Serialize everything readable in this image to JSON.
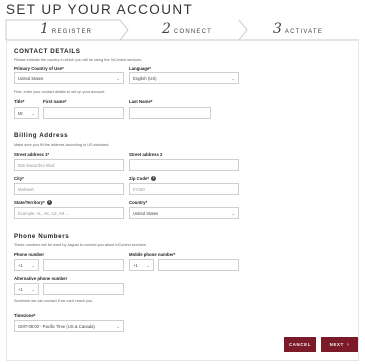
{
  "page": {
    "title": "SET UP YOUR ACCOUNT"
  },
  "steps": [
    {
      "number": "1",
      "label": "REGISTER"
    },
    {
      "number": "2",
      "label": "CONNECT"
    },
    {
      "number": "3",
      "label": "ACTIVATE"
    }
  ],
  "contact": {
    "heading": "CONTACT DETAILS",
    "note_country": "Please indicate the country in which you will be using the InControl services.",
    "country_label": "Primary Country of Use*",
    "country_value": "United States",
    "language_label": "Language*",
    "language_value": "English (US)",
    "note_details": "First, enter your contact details to set up your account.",
    "title_label": "Title*",
    "title_value": "Mr",
    "first_name_label": "First name*",
    "first_name_value": "",
    "last_name_label": "Last Name*",
    "last_name_value": ""
  },
  "billing": {
    "heading": "Billing Address",
    "note": "Make sure you fill the address according to US standard.",
    "street1_label": "Street address 1*",
    "street1_placeholder": "555 Macarthur Blvd",
    "street2_label": "Street address 2",
    "street2_value": "",
    "city_label": "City*",
    "city_placeholder": "Mahwah",
    "zip_label": "Zip Code*",
    "zip_placeholder": "07430",
    "state_label": "State/Territory*",
    "state_placeholder": "Example: AL, AK, AZ, AR ...",
    "country_label": "Country*",
    "country_value": "United States"
  },
  "phones": {
    "heading": "Phone Numbers",
    "note": "These numbers will be used by Jaguar to contact you about InControl services.",
    "phone_label": "Phone number",
    "phone_code": "+1",
    "mobile_label": "Mobile phone number*",
    "mobile_code": "+1",
    "alt_label": "Alternative phone number",
    "alt_code": "+1",
    "note_alt": "Someone we can contact if we can't reach you."
  },
  "timezone": {
    "label": "Timezone*",
    "value": "GMT-08:00 - Pacific Time (US & Canada)"
  },
  "actions": {
    "cancel_label": "CANCEL",
    "next_label": "NEXT"
  },
  "icons": {
    "select_chevron": "chevron-down-icon",
    "info": "info-icon",
    "next_arrow": "chevron-right-icon"
  },
  "colors": {
    "accent": "#7b1b2a",
    "tab_border": "#c8c8c8"
  }
}
